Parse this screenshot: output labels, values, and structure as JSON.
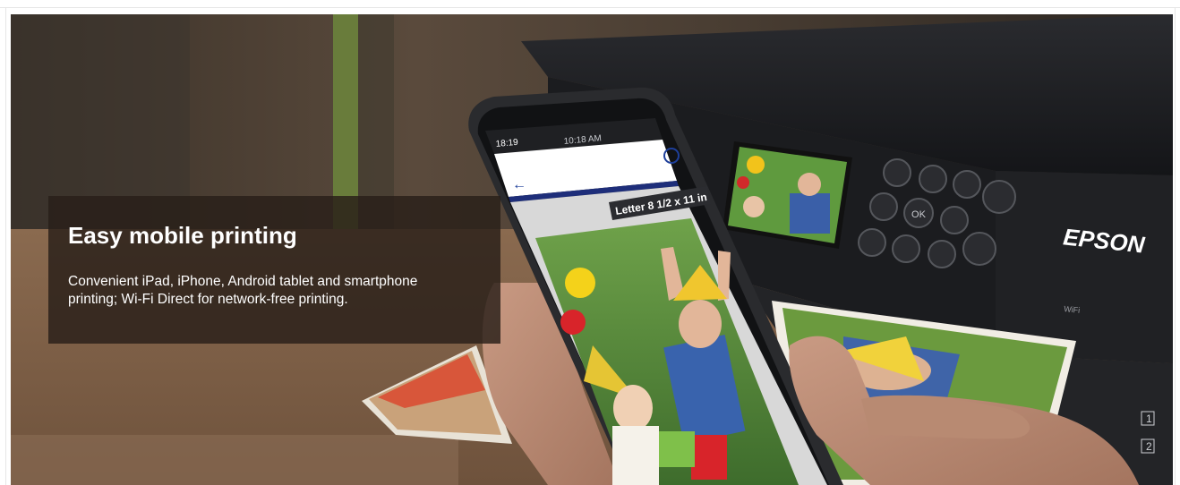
{
  "banner": {
    "title": "Easy mobile printing",
    "description": "Convenient  iPad, iPhone, Android tablet and smartphone\nprinting; Wi-Fi Direct for network-free printing."
  },
  "photo": {
    "printer_brand": "EPSON",
    "printer_wifi_badge": "WiFi",
    "phone_time_left": "18:19",
    "phone_time_center": "10:18 AM",
    "paper_size_label": "Letter 8 1/2 x 11 in",
    "tray_labels": [
      "1",
      "2"
    ],
    "control_ok_label": "OK"
  },
  "colors": {
    "caption_bg": "#281e18",
    "printer_body": "#1b1c1f",
    "phone_frame": "#2a2b2e"
  }
}
